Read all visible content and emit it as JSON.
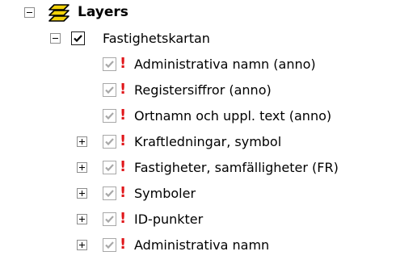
{
  "tree": {
    "root": {
      "label": "Layers",
      "icon": "layers-icon",
      "expanded": true
    },
    "group": {
      "label": "Fastighetskartan",
      "checked": true,
      "expanded": true
    },
    "items": [
      {
        "label": "Administrativa namn (anno)",
        "checked": true,
        "expandable": false,
        "warning": "!"
      },
      {
        "label": "Registersiffror (anno)",
        "checked": true,
        "expandable": false,
        "warning": "!"
      },
      {
        "label": "Ortnamn och uppl. text (anno)",
        "checked": true,
        "expandable": false,
        "warning": "!"
      },
      {
        "label": "Kraftledningar, symbol",
        "checked": true,
        "expandable": true,
        "warning": "!"
      },
      {
        "label": "Fastigheter, samfälligheter (FR)",
        "checked": true,
        "expandable": true,
        "warning": "!"
      },
      {
        "label": "Symboler",
        "checked": true,
        "expandable": true,
        "warning": "!"
      },
      {
        "label": "ID-punkter",
        "checked": true,
        "expandable": true,
        "warning": "!"
      },
      {
        "label": "Administrativa namn",
        "checked": true,
        "expandable": true,
        "warning": "!"
      }
    ]
  },
  "colors": {
    "warning": "#e0161a",
    "layer_icon": "#f2d20a",
    "dim_check": "#a8a8a8"
  }
}
